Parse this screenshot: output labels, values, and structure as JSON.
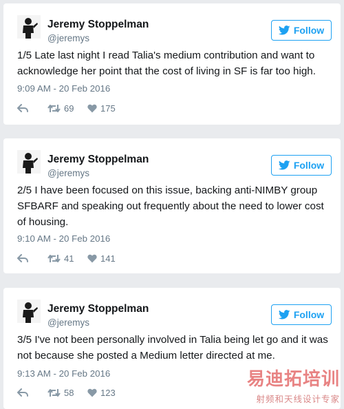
{
  "tweets": [
    {
      "name": "Jeremy Stoppelman",
      "handle": "@jeremys",
      "follow_label": "Follow",
      "text": "1/5 Late last night I read Talia's medium contribution and want to acknowledge her point that the cost of living in SF is far too high.",
      "time": "9:09 AM - 20 Feb 2016",
      "retweets": "69",
      "likes": "175"
    },
    {
      "name": "Jeremy Stoppelman",
      "handle": "@jeremys",
      "follow_label": "Follow",
      "text": "2/5 I have been focused on this issue, backing anti-NIMBY group SFBARF and speaking out frequently about the need to lower cost of housing.",
      "time": "9:10 AM - 20 Feb 2016",
      "retweets": "41",
      "likes": "141"
    },
    {
      "name": "Jeremy Stoppelman",
      "handle": "@jeremys",
      "follow_label": "Follow",
      "text": "3/5 I've not been personally involved in Talia being let go and it was not because she posted a Medium letter directed at me.",
      "time": "9:13 AM - 20 Feb 2016",
      "retweets": "58",
      "likes": "123"
    }
  ],
  "watermark": {
    "title": "易迪拓培训",
    "subtitle": "射频和天线设计专家"
  },
  "colors": {
    "background": "#e9ebee",
    "card": "#ffffff",
    "twitter_blue": "#1da1f2",
    "secondary_text": "#657786",
    "watermark": "#e15a5a"
  },
  "icons": [
    "avatar-icon",
    "twitter-bird-icon",
    "reply-icon",
    "retweet-icon",
    "heart-icon"
  ]
}
